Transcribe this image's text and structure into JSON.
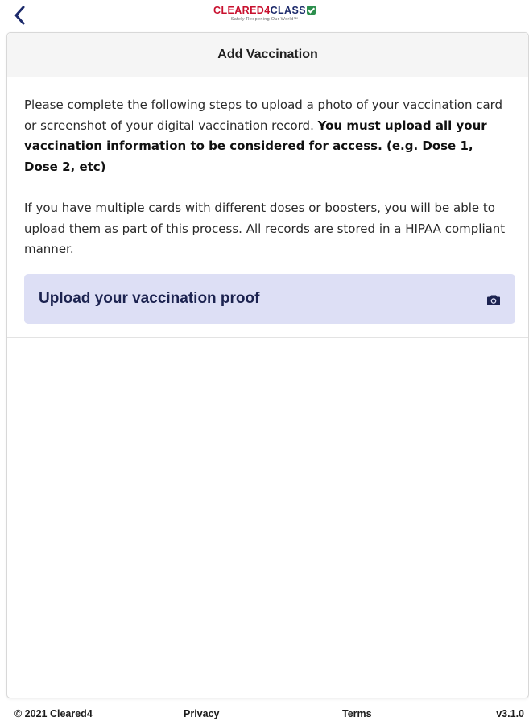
{
  "header": {
    "logo": {
      "part1": "CLEARED4",
      "part2": "CLASS",
      "tagline": "Safely Reopening Our World™"
    }
  },
  "card": {
    "title": "Add Vaccination",
    "intro_text": "Please complete the following steps to upload a photo of your vaccination card or screenshot of your digital vaccination record. ",
    "intro_bold": "You must upload all your vaccination information to be considered for access. (e.g. Dose 1, Dose 2, etc)",
    "multiple_cards_text": "If you have multiple cards with different doses or boosters, you will be able to upload them as part of this process. All records are stored in a HIPAA compliant manner.",
    "upload_label": "Upload your vaccination proof"
  },
  "footer": {
    "copyright": "© 2021 Cleared4",
    "privacy": "Privacy",
    "terms": "Terms",
    "version": "v3.1.0"
  },
  "colors": {
    "brand_red": "#c8102e",
    "brand_navy": "#1c2a6b",
    "upload_bg": "#dddff5",
    "back_arrow": "#1c2a6b"
  },
  "icons": {
    "back": "chevron-left-icon",
    "upload": "camera-icon",
    "logo_check": "check-square-icon"
  }
}
